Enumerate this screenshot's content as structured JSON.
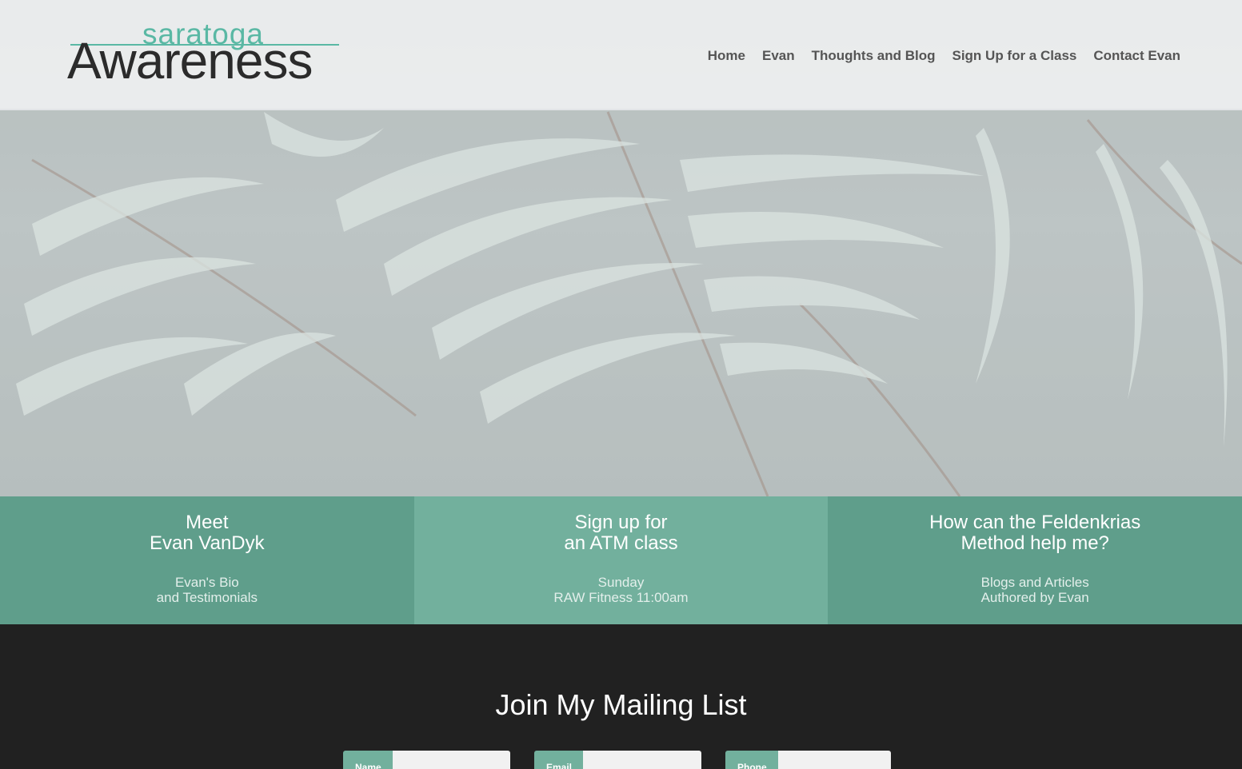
{
  "header": {
    "logo_small": "saratoga",
    "logo_big": "Awareness",
    "nav": [
      "Home",
      "Evan",
      "Thoughts and Blog",
      "Sign Up for a Class",
      "Contact Evan"
    ]
  },
  "features": [
    {
      "title": "Meet\nEvan VanDyk",
      "sub": "Evan's Bio\nand Testimonials"
    },
    {
      "title": "Sign up for\nan ATM class",
      "sub": "Sunday\nRAW Fitness 11:00am"
    },
    {
      "title": "How can the Feldenkrias\nMethod help me?",
      "sub": "Blogs and Articles\nAuthored by Evan"
    }
  ],
  "mailing": {
    "title": "Join My Mailing List",
    "fields": [
      "Name",
      "Email",
      "Phone"
    ]
  },
  "colors": {
    "accent_dark": "#5f9e8b",
    "accent_light": "#72b09d",
    "logo_teal": "#5ab8a4",
    "footer_bg": "#212121"
  }
}
